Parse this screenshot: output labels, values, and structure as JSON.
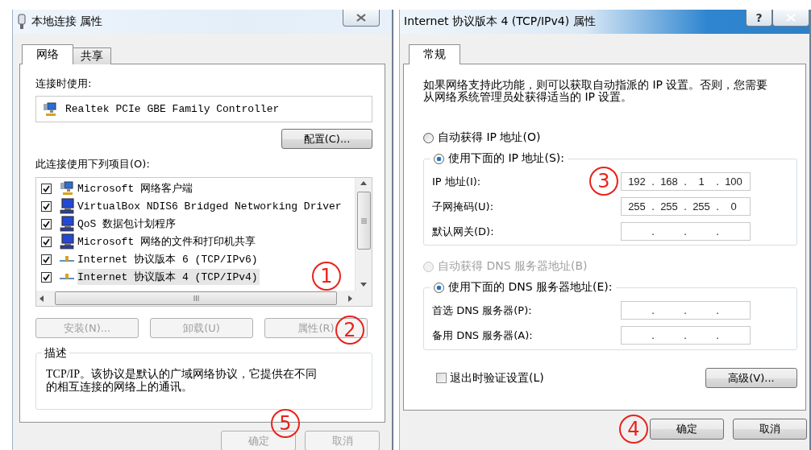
{
  "left_dialog": {
    "title": "本地连接 属性",
    "tabs": [
      {
        "label": "网络",
        "selected": true
      },
      {
        "label": "共享",
        "selected": false
      }
    ],
    "connect_using_label": "连接时使用:",
    "adapter": "Realtek PCIe GBE Family Controller",
    "configure_button": "配置(C)...",
    "items_label": "此连接使用下列项目(O):",
    "items": [
      {
        "label": "Microsoft 网络客户端",
        "checked": true,
        "selected": false,
        "kind": "client"
      },
      {
        "label": "VirtualBox NDIS6 Bridged Networking Driver",
        "checked": true,
        "selected": false,
        "kind": "service"
      },
      {
        "label": "QoS 数据包计划程序",
        "checked": true,
        "selected": false,
        "kind": "service"
      },
      {
        "label": "Microsoft 网络的文件和打印机共享",
        "checked": true,
        "selected": false,
        "kind": "service"
      },
      {
        "label": "Internet 协议版本 6 (TCP/IPv6)",
        "checked": true,
        "selected": false,
        "kind": "protocol"
      },
      {
        "label": "Internet 协议版本 4 (TCP/IPv4)",
        "checked": true,
        "selected": true,
        "kind": "protocol",
        "annotation": "1"
      }
    ],
    "item_buttons": [
      {
        "label": "安装(N)...",
        "disabled": true
      },
      {
        "label": "卸载(U)",
        "disabled": true
      },
      {
        "label": "属性(R)",
        "disabled": true,
        "annotation": "2"
      }
    ],
    "description_label": "描述",
    "description": "TCP/IP。该协议是默认的广域网络协议，它提供在不同的相互连接的网络上的通讯。",
    "buttons": [
      {
        "label": "确定",
        "disabled": true,
        "annotation": "5"
      },
      {
        "label": "取消",
        "disabled": true
      }
    ]
  },
  "right_dialog": {
    "title": "Internet 协议版本 4 (TCP/IPv4) 属性",
    "help_button": "?",
    "tabs": [
      {
        "label": "常规",
        "selected": true
      }
    ],
    "intro": "如果网络支持此功能，则可以获取自动指派的 IP 设置。否则，您需要从网络系统管理员处获得适当的 IP 设置。",
    "ip_mode": [
      {
        "label": "自动获得 IP 地址(O)",
        "selected": false,
        "disabled": false
      },
      {
        "label": "使用下面的 IP 地址(S):",
        "selected": true,
        "disabled": false
      }
    ],
    "ip_fields": [
      {
        "label": "IP 地址(I):",
        "parts": [
          "192",
          ".",
          "168",
          ".",
          "1",
          ".",
          "100"
        ],
        "annotation": "3"
      },
      {
        "label": "子网掩码(U):",
        "parts": [
          "255",
          ".",
          "255",
          ".",
          "255",
          ".",
          "0"
        ]
      },
      {
        "label": "默认网关(D):",
        "parts": [
          ".",
          ".",
          "."
        ]
      }
    ],
    "dns_mode": [
      {
        "label": "自动获得 DNS 服务器地址(B)",
        "selected": false,
        "disabled": true
      },
      {
        "label": "使用下面的 DNS 服务器地址(E):",
        "selected": true,
        "disabled": false
      }
    ],
    "dns_fields": [
      {
        "label": "首选 DNS 服务器(P):",
        "parts": [
          ".",
          ".",
          "."
        ]
      },
      {
        "label": "备用 DNS 服务器(A):",
        "parts": [
          ".",
          ".",
          "."
        ]
      }
    ],
    "validate": {
      "label": "退出时验证设置(L)",
      "checked": false
    },
    "advanced_button": "高级(V)...",
    "buttons": [
      {
        "label": "确定",
        "annotation": "4"
      },
      {
        "label": "取消"
      }
    ]
  }
}
